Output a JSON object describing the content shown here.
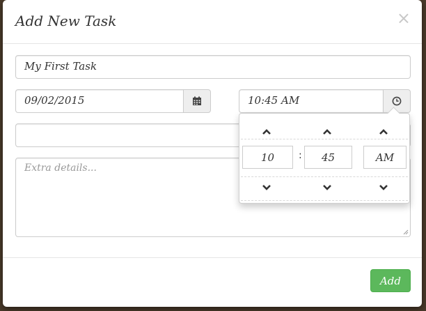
{
  "modal": {
    "title": "Add New Task",
    "close_symbol": "×"
  },
  "task_name": {
    "value": "My First Task"
  },
  "date": {
    "value": "09/02/2015",
    "icon": "calendar-icon"
  },
  "time": {
    "value": "10:45 AM",
    "icon": "clock-icon"
  },
  "details": {
    "placeholder": "Extra details..."
  },
  "time_picker": {
    "hour": "10",
    "separator": ":",
    "minute": "45",
    "meridian": "AM",
    "up_icon": "chevron-up-icon",
    "down_icon": "chevron-down-icon"
  },
  "footer": {
    "add_label": "Add"
  },
  "colors": {
    "primary_button": "#5cb85c",
    "border": "#cccccc",
    "addon_bg": "#eeeeee"
  }
}
